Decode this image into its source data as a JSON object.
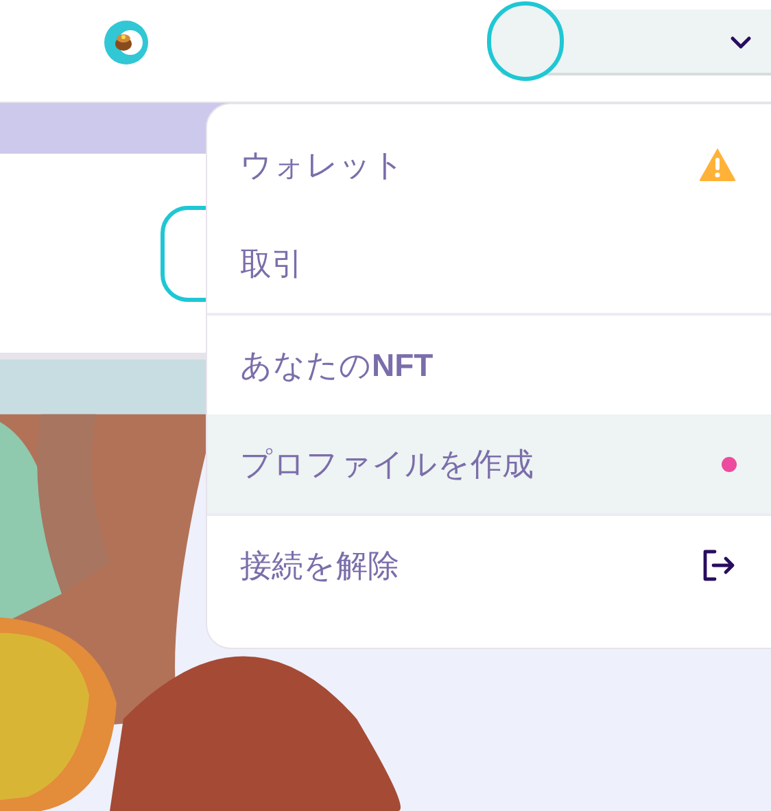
{
  "menu": {
    "sections": [
      {
        "items": [
          {
            "label": "ウォレット",
            "kind": "warning",
            "selected": false
          },
          {
            "label": "取引",
            "kind": "plain",
            "selected": false
          }
        ]
      },
      {
        "items": [
          {
            "label": "あなたの**NFT**",
            "kind": "plain",
            "selected": false
          },
          {
            "label": "プロファイルを作成",
            "kind": "dot",
            "selected": true,
            "color": "#ed4b9e"
          }
        ]
      },
      {
        "items": [
          {
            "label": "接続を解除",
            "kind": "logout",
            "selected": false
          }
        ]
      }
    ]
  }
}
